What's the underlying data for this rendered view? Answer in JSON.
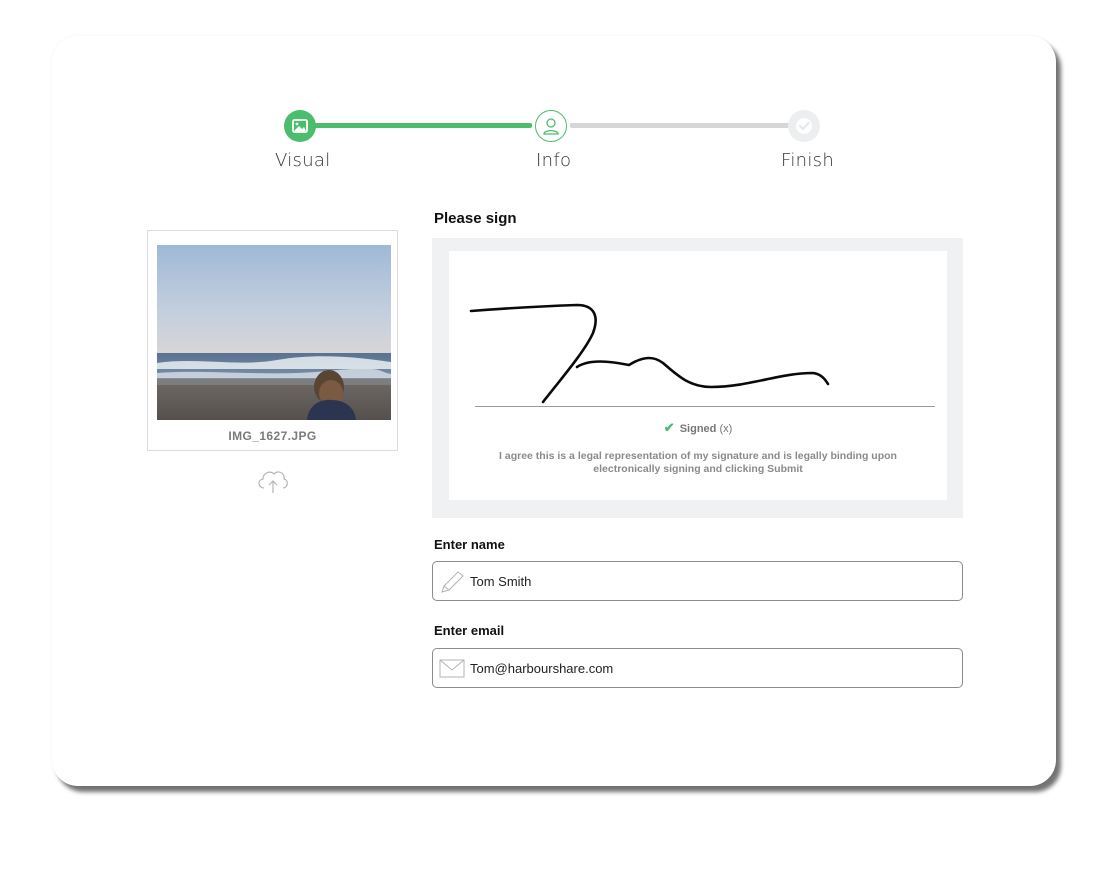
{
  "stepper": {
    "steps": [
      {
        "label": "Visual",
        "state": "complete"
      },
      {
        "label": "Info",
        "state": "current"
      },
      {
        "label": "Finish",
        "state": "pending"
      }
    ]
  },
  "upload": {
    "file_name": "IMG_1627.JPG"
  },
  "signature": {
    "title": "Please sign",
    "status": "Signed",
    "clear_label": "(x)",
    "agreement_text": "I agree this is a legal representation of my signature and is legally binding upon electronically signing and clicking Submit"
  },
  "name_field": {
    "label": "Enter name",
    "value": "Tom Smith"
  },
  "email_field": {
    "label": "Enter email",
    "value": "Tom@harbourshare.com"
  },
  "colors": {
    "accent": "#4cbd6c",
    "track_pending": "#d6d6d6",
    "signature_bg": "#eff1f3"
  }
}
